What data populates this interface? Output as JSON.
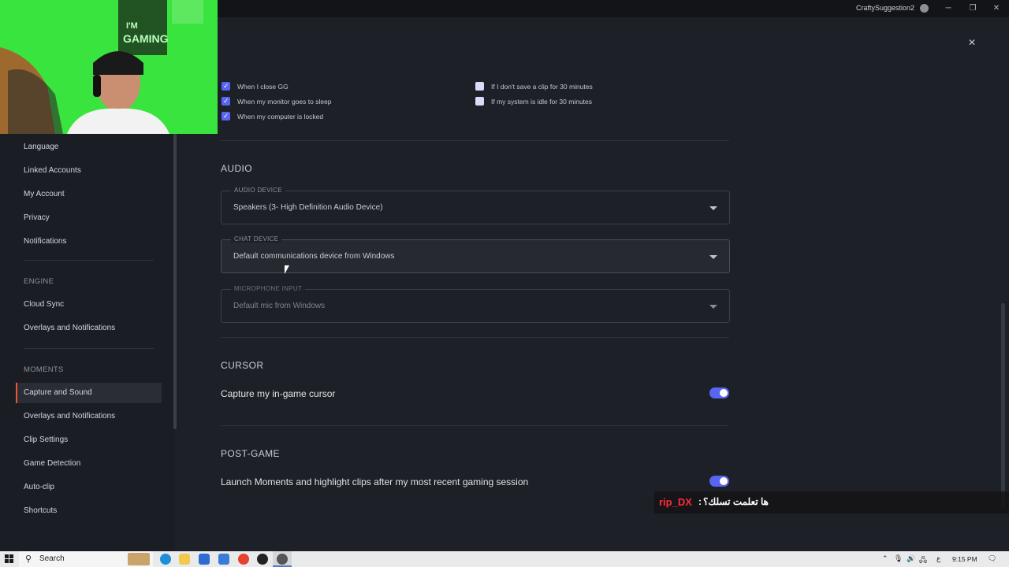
{
  "titlebar": {
    "user_name": "CraftySuggestion2",
    "minimize": "─",
    "restore": "❐",
    "close": "✕"
  },
  "webcam": {
    "poster_text_1": "I'M",
    "poster_text_2": "GAMING"
  },
  "sidebar": {
    "items_top": [
      "Language",
      "Linked Accounts",
      "My Account",
      "Privacy",
      "Notifications"
    ],
    "engine_header": "ENGINE",
    "engine_items": [
      "Cloud Sync",
      "Overlays and Notifications"
    ],
    "moments_header": "MOMENTS",
    "moments_items": [
      "Capture and Sound",
      "Overlays and Notifications",
      "Clip Settings",
      "Game Detection",
      "Auto-clip",
      "Shortcuts"
    ],
    "active_item": "Capture and Sound"
  },
  "recording_stop": {
    "left": [
      {
        "label": "When I close GG",
        "checked": true
      },
      {
        "label": "When my monitor goes to sleep",
        "checked": true
      },
      {
        "label": "When my computer is locked",
        "checked": true
      }
    ],
    "right": [
      {
        "label": "If I don't save a clip for 30 minutes",
        "checked": false
      },
      {
        "label": "If my system is idle for 30 minutes",
        "checked": false
      }
    ]
  },
  "audio": {
    "title": "AUDIO",
    "audio_device": {
      "label": "AUDIO DEVICE",
      "value": "Speakers (3- High Definition Audio Device)"
    },
    "chat_device": {
      "label": "CHAT DEVICE",
      "value": "Default communications device from Windows"
    },
    "microphone_input": {
      "label": "MICROPHONE INPUT",
      "value": "Default mic from Windows"
    }
  },
  "cursor_section": {
    "title": "CURSOR",
    "toggle_label": "Capture my in-game cursor",
    "enabled": true
  },
  "post_game": {
    "title": "POST-GAME",
    "toggle_label": "Launch Moments and highlight clips after my most recent gaming session",
    "enabled": true
  },
  "chat_overlay": {
    "user": "rip_DX",
    "separator": ":",
    "message": "ها تعلمت تسلك؟"
  },
  "taskbar": {
    "search_label": "Search",
    "time": "9:15 PM",
    "lang": "ع",
    "colors": {
      "accent": "#5765f2",
      "active_bar": "#ee5533"
    }
  }
}
